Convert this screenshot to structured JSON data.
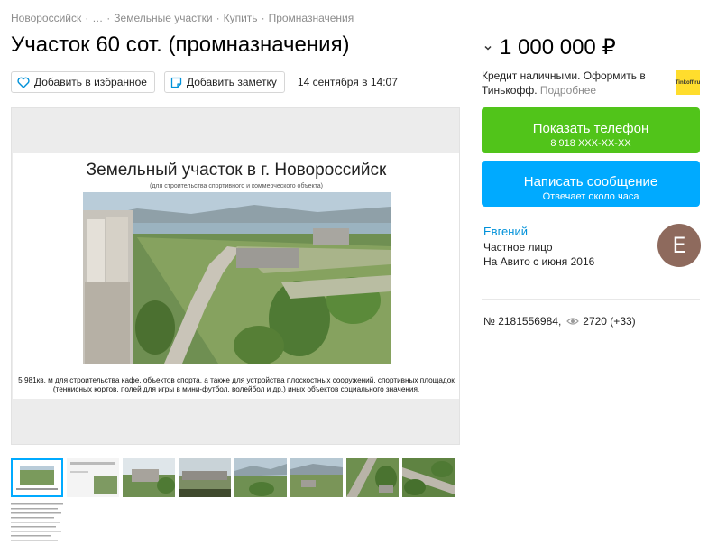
{
  "breadcrumbs": [
    "Новороссийск",
    "…",
    "Земельные участки",
    "Купить",
    "Промназначения"
  ],
  "breadcrumb_sep": "·",
  "title": "Участок 60 сот. (промназначения)",
  "actions": {
    "favorite_label": "Добавить в избранное",
    "note_label": "Добавить заметку",
    "date": "14 сентября в 14:07"
  },
  "gallery": {
    "slide_title": "Земельный участок в г. Новороссийск",
    "slide_subtitle": "(для строительства спортивного и коммерческого объекта)",
    "slide_caption": "5 981кв. м для строительства кафе, объектов спорта, а также для устройства плоскостных сооружений, спортивных площадок (теннисных кортов, полей для игры в мини-футбол, волейбол и др.) иных объектов социального значения."
  },
  "price": "1 000 000 ₽",
  "credit": {
    "text": "Кредит наличными. Оформить в Тинькофф.",
    "more": "Подробнее",
    "logo_text": "Tinkoff.ru"
  },
  "phone_button": {
    "label": "Показать телефон",
    "sub": "8 918 XXX-XX-XX"
  },
  "message_button": {
    "label": "Написать сообщение",
    "sub": "Отвечает около часа"
  },
  "seller": {
    "name": "Евгений",
    "type": "Частное лицо",
    "since": "На Авито с июня 2016",
    "avatar_letter": "E"
  },
  "meta": {
    "id": "№ 2181556984,",
    "views": "2720 (+33)"
  },
  "colors": {
    "phone_button": "#51c41a",
    "message_button": "#00aaff",
    "link": "#0091d9",
    "avatar": "#8e6a5d",
    "tinkoff": "#ffdd2d"
  },
  "icons": [
    "heart-icon",
    "note-icon",
    "chevron-down-icon",
    "eye-icon"
  ]
}
